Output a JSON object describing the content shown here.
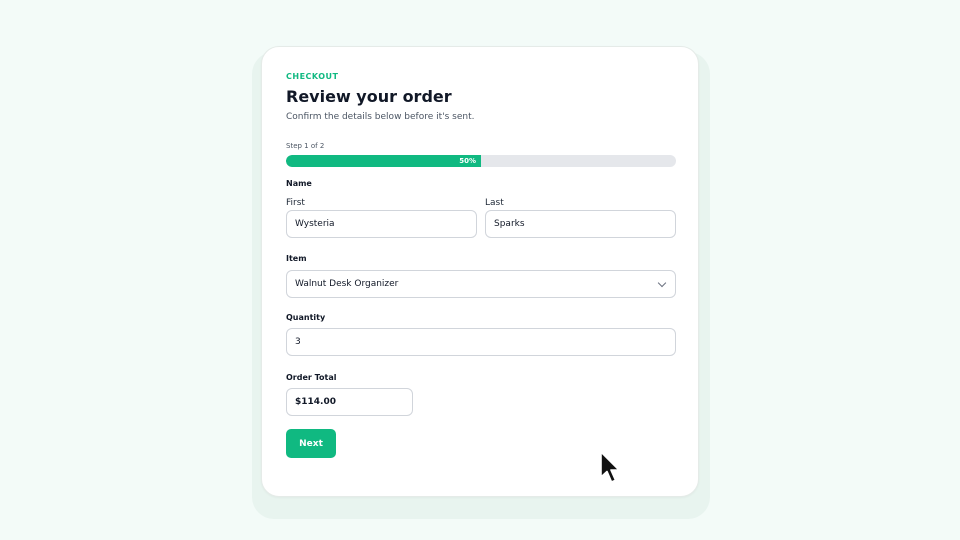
{
  "header": {
    "eyebrow": "CHECKOUT",
    "title": "Review your order",
    "subtitle": "Confirm the details below before it's sent."
  },
  "progress": {
    "step_text": "Step 1 of 2",
    "percent_label": "50%",
    "fraction": 0.5
  },
  "name": {
    "section_label": "Name",
    "first_label": "First",
    "first_value": "Wysteria",
    "last_label": "Last",
    "last_value": "Sparks"
  },
  "item": {
    "label": "Item",
    "selected": "Walnut Desk Organizer"
  },
  "quantity": {
    "label": "Quantity",
    "value": "3"
  },
  "order_total": {
    "label": "Order Total",
    "value": "$114.00"
  },
  "actions": {
    "next_label": "Next"
  },
  "colors": {
    "accent": "#10b981",
    "background": "#f3fbf8"
  }
}
